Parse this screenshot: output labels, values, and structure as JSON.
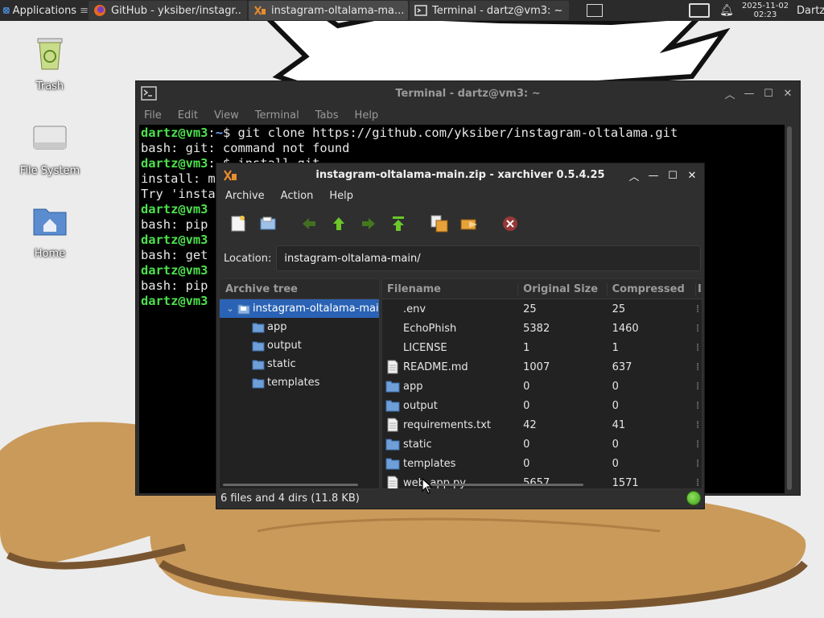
{
  "panel": {
    "applications_label": "Applications",
    "tasks": [
      {
        "label": "GitHub - yksiber/instagr...",
        "icon": "firefox-icon"
      },
      {
        "label": "instagram-oltalama-ma...",
        "icon": "xarchiver-icon"
      },
      {
        "label": "Terminal - dartz@vm3: ~",
        "icon": "terminal-icon"
      }
    ],
    "date": "2025-11-02",
    "time": "02:23",
    "user": "Dartz"
  },
  "desktop_icons": [
    {
      "label": "Trash",
      "icon": "trash-icon"
    },
    {
      "label": "File System",
      "icon": "drive-icon"
    },
    {
      "label": "Home",
      "icon": "home-folder-icon"
    }
  ],
  "terminal": {
    "title": "Terminal - dartz@vm3: ~",
    "menu": [
      "File",
      "Edit",
      "View",
      "Terminal",
      "Tabs",
      "Help"
    ],
    "prompt_user": "dartz@vm3",
    "prompt_sep": ":",
    "prompt_path": "~",
    "prompt_sym": "$",
    "lines": [
      {
        "type": "prompt",
        "cmd": " git clone https://github.com/yksiber/instagram-oltalama.git"
      },
      {
        "type": "out",
        "text": "bash: git: command not found"
      },
      {
        "type": "prompt",
        "cmd": " install git"
      },
      {
        "type": "out",
        "text": "install: m"
      },
      {
        "type": "out",
        "text": "Try 'insta"
      },
      {
        "type": "prompt_short",
        "text": "dartz@vm3"
      },
      {
        "type": "out",
        "text": "bash: pip"
      },
      {
        "type": "prompt_short",
        "text": "dartz@vm3"
      },
      {
        "type": "out",
        "text": "bash: get"
      },
      {
        "type": "prompt_short",
        "text": "dartz@vm3"
      },
      {
        "type": "out",
        "text": "bash: pip"
      },
      {
        "type": "prompt_short",
        "text": "dartz@vm3"
      }
    ]
  },
  "xarchiver": {
    "title": "instagram-oltalama-main.zip - xarchiver 0.5.4.25",
    "menu": [
      "Archive",
      "Action",
      "Help"
    ],
    "toolbar": [
      {
        "name": "new-archive-icon"
      },
      {
        "name": "open-archive-icon"
      },
      {
        "name": "back-icon"
      },
      {
        "name": "up-icon"
      },
      {
        "name": "forward-icon"
      },
      {
        "name": "home-top-icon"
      },
      {
        "name": "extract-icon"
      },
      {
        "name": "add-icon"
      },
      {
        "name": "cancel-icon"
      }
    ],
    "location_label": "Location:",
    "location_value": "instagram-oltalama-main/",
    "tree_header": "Archive tree",
    "tree": [
      {
        "label": "instagram-oltalama-mai",
        "level": 0,
        "expanded": true,
        "selected": true
      },
      {
        "label": "app",
        "level": 1
      },
      {
        "label": "output",
        "level": 1
      },
      {
        "label": "static",
        "level": 1
      },
      {
        "label": "templates",
        "level": 1
      }
    ],
    "columns": [
      "Filename",
      "Original Size",
      "Compressed",
      "I"
    ],
    "files": [
      {
        "name": ".env",
        "orig": "25",
        "comp": "25",
        "kind": "none"
      },
      {
        "name": "EchoPhish",
        "orig": "5382",
        "comp": "1460",
        "kind": "none"
      },
      {
        "name": "LICENSE",
        "orig": "1",
        "comp": "1",
        "kind": "none"
      },
      {
        "name": "README.md",
        "orig": "1007",
        "comp": "637",
        "kind": "doc"
      },
      {
        "name": "app",
        "orig": "0",
        "comp": "0",
        "kind": "folder"
      },
      {
        "name": "output",
        "orig": "0",
        "comp": "0",
        "kind": "folder"
      },
      {
        "name": "requirements.txt",
        "orig": "42",
        "comp": "41",
        "kind": "doc"
      },
      {
        "name": "static",
        "orig": "0",
        "comp": "0",
        "kind": "folder"
      },
      {
        "name": "templates",
        "orig": "0",
        "comp": "0",
        "kind": "folder"
      },
      {
        "name": "web_app.py",
        "orig": "5657",
        "comp": "1571",
        "kind": "doc"
      }
    ],
    "status": "6 files and 4 dirs  (11.8 KB)"
  }
}
